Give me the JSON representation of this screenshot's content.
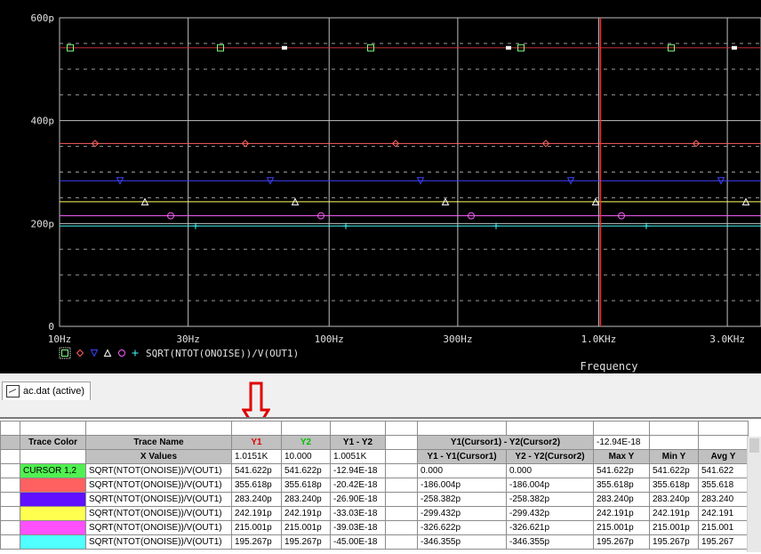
{
  "plot": {
    "y_ticks": [
      "600p",
      "400p",
      "200p",
      "0"
    ],
    "x_ticks": [
      "10Hz",
      "30Hz",
      "100Hz",
      "300Hz",
      "1.0KHz",
      "3.0KHz"
    ],
    "x_label": "Frequency",
    "legend_expr": "SQRT(NTOT(ONOISE))/V(OUT1)",
    "colors": {
      "background": "#000000",
      "grid": "#c0c0c0",
      "cursor": "#ff3030",
      "trace1": "#c03030",
      "trace2": "#ff6060",
      "trace3": "#4040ff",
      "trace4": "#ffff60",
      "trace5": "#ff60ff",
      "trace6": "#40ffff"
    }
  },
  "chart_data": {
    "type": "line",
    "title": "",
    "xlabel": "Frequency",
    "ylabel": "",
    "x_scale": "log",
    "xlim": [
      10,
      4000
    ],
    "ylim": [
      0,
      600
    ],
    "cursor_x": 1015.1,
    "series": [
      {
        "name": "SQRT(NTOT(ONOISE))/V(OUT1)",
        "color": "#c03030",
        "marker": "square",
        "values": [
          541.622
        ]
      },
      {
        "name": "SQRT(NTOT(ONOISE))/V(OUT1)",
        "color": "#ff6060",
        "marker": "diamond",
        "values": [
          355.618
        ]
      },
      {
        "name": "SQRT(NTOT(ONOISE))/V(OUT1)",
        "color": "#4040ff",
        "marker": "triangle-down",
        "values": [
          283.24
        ]
      },
      {
        "name": "SQRT(NTOT(ONOISE))/V(OUT1)",
        "color": "#ffff60",
        "marker": "triangle-up",
        "values": [
          242.191
        ]
      },
      {
        "name": "SQRT(NTOT(ONOISE))/V(OUT1)",
        "color": "#ff60ff",
        "marker": "circle",
        "values": [
          215.001
        ]
      },
      {
        "name": "SQRT(NTOT(ONOISE))/V(OUT1)",
        "color": "#40ffff",
        "marker": "plus",
        "values": [
          195.267
        ]
      }
    ]
  },
  "tab": {
    "label": "ac.dat (active)"
  },
  "table": {
    "headers": {
      "trace_color": "Trace Color",
      "trace_name": "Trace Name",
      "y1": "Y1",
      "y2": "Y2",
      "y1_minus_y2": "Y1 - Y2",
      "cursor_diff": "Y1(Cursor1) - Y2(Cursor2)",
      "cursor_diff_value": "-12.94E-18",
      "x_values": "X Values",
      "x_y1": "1.0151K",
      "x_y2": "10.000",
      "x_diff": "1.0051K",
      "y1_minus_y1c": "Y1 - Y1(Cursor1)",
      "y2_minus_y2c": "Y2 - Y2(Cursor2)",
      "max_y": "Max Y",
      "min_y": "Min Y",
      "avg_y": "Avg Y"
    },
    "rows": [
      {
        "color_label": "CURSOR 1,2",
        "color": "#50f050",
        "name": "SQRT(NTOT(ONOISE))/V(OUT1)",
        "y1": "541.622p",
        "y2": "541.622p",
        "diff": "-12.94E-18",
        "c1": "0.000",
        "c2": "0.000",
        "max": "541.622p",
        "min": "541.622p",
        "avg": "541.622"
      },
      {
        "color_label": "",
        "color": "#ff6060",
        "name": "SQRT(NTOT(ONOISE))/V(OUT1)",
        "y1": "355.618p",
        "y2": "355.618p",
        "diff": "-20.42E-18",
        "c1": "-186.004p",
        "c2": "-186.004p",
        "max": "355.618p",
        "min": "355.618p",
        "avg": "355.618"
      },
      {
        "color_label": "",
        "color": "#6010ff",
        "name": "SQRT(NTOT(ONOISE))/V(OUT1)",
        "y1": "283.240p",
        "y2": "283.240p",
        "diff": "-26.90E-18",
        "c1": "-258.382p",
        "c2": "-258.382p",
        "max": "283.240p",
        "min": "283.240p",
        "avg": "283.240"
      },
      {
        "color_label": "",
        "color": "#ffff50",
        "name": "SQRT(NTOT(ONOISE))/V(OUT1)",
        "y1": "242.191p",
        "y2": "242.191p",
        "diff": "-33.03E-18",
        "c1": "-299.432p",
        "c2": "-299.432p",
        "max": "242.191p",
        "min": "242.191p",
        "avg": "242.191"
      },
      {
        "color_label": "",
        "color": "#ff50ff",
        "name": "SQRT(NTOT(ONOISE))/V(OUT1)",
        "y1": "215.001p",
        "y2": "215.001p",
        "diff": "-39.03E-18",
        "c1": "-326.622p",
        "c2": "-326.621p",
        "max": "215.001p",
        "min": "215.001p",
        "avg": "215.001"
      },
      {
        "color_label": "",
        "color": "#50ffff",
        "name": "SQRT(NTOT(ONOISE))/V(OUT1)",
        "y1": "195.267p",
        "y2": "195.267p",
        "diff": "-45.00E-18",
        "c1": "-346.355p",
        "c2": "-346.355p",
        "max": "195.267p",
        "min": "195.267p",
        "avg": "195.267"
      }
    ]
  }
}
